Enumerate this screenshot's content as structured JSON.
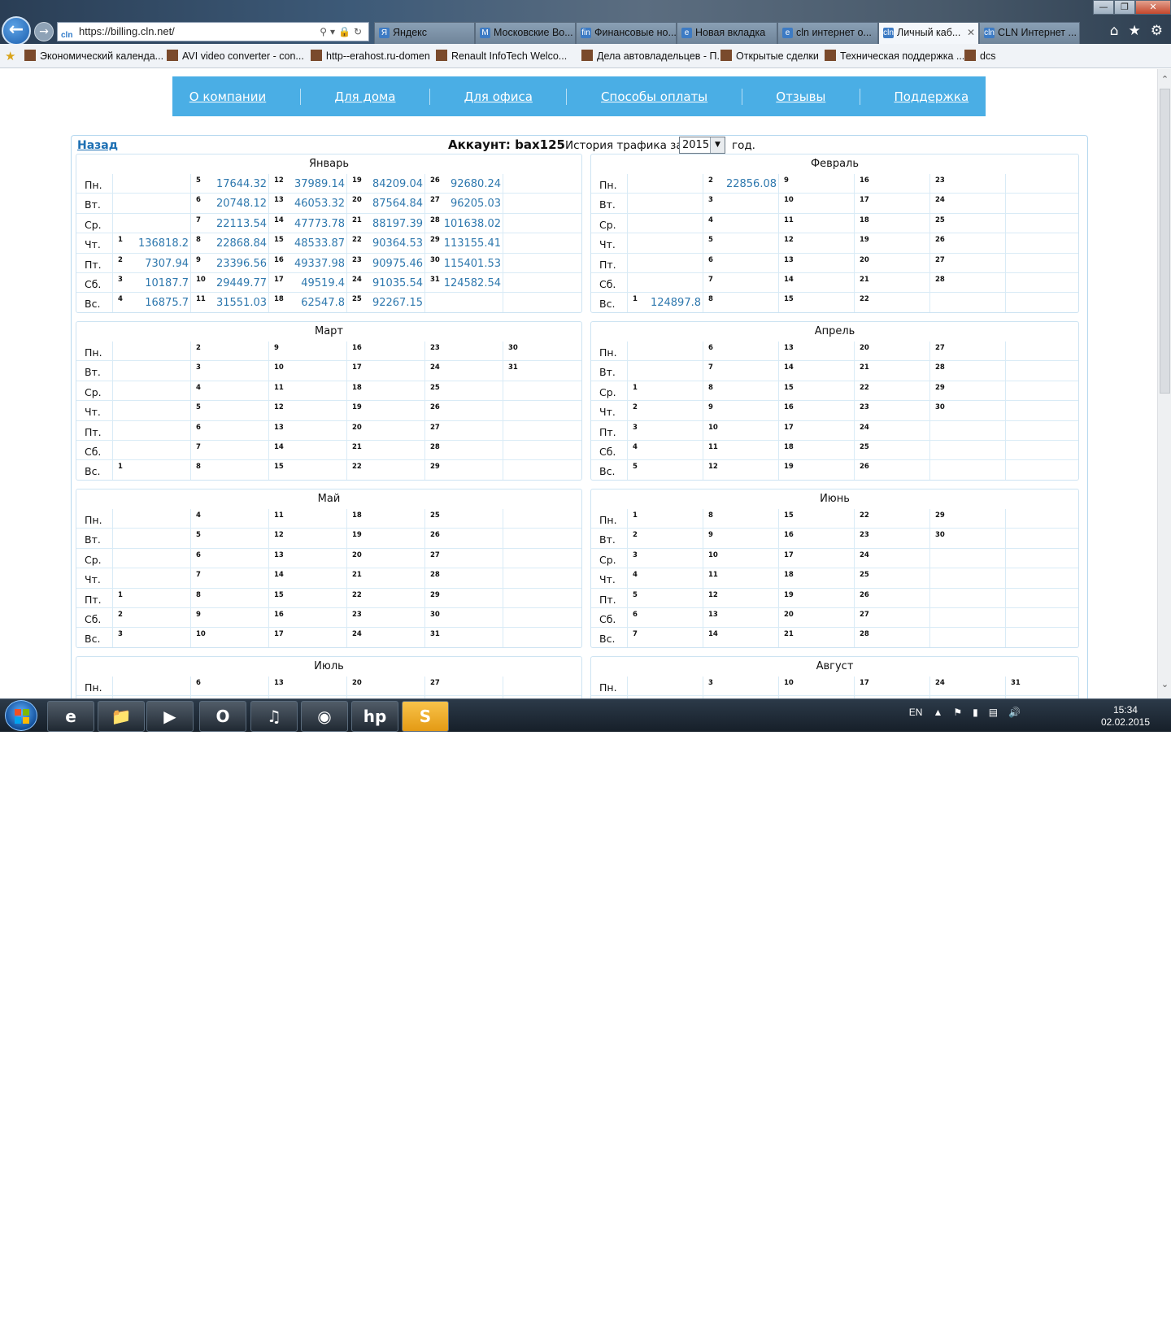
{
  "browser": {
    "url": "https://billing.cln.net/",
    "tabs": [
      {
        "label": "Яндекс",
        "icon": "Я",
        "active": false
      },
      {
        "label": "Московские Во...",
        "icon": "М",
        "active": false
      },
      {
        "label": "Финансовые но...",
        "icon": "fin",
        "active": false
      },
      {
        "label": "Новая вкладка",
        "icon": "e",
        "active": false
      },
      {
        "label": "cln интернет о...",
        "icon": "e",
        "active": false
      },
      {
        "label": "Личный каб...",
        "icon": "cln",
        "active": true
      },
      {
        "label": "CLN Интернет ...",
        "icon": "cln",
        "active": false
      }
    ],
    "favorites": [
      "Экономический календа...",
      "AVI video converter - con...",
      "http--erahost.ru-domen",
      "Renault InfoTech  Welco...",
      "Дела автовладельцев - П...",
      "Открытые сделки",
      "Техническая поддержка ...",
      "dcs"
    ]
  },
  "menu": [
    "О компании",
    "Для дома",
    "Для офиса",
    "Способы оплаты",
    "Отзывы",
    "Поддержка"
  ],
  "header": {
    "back_label": "Назад",
    "account_label": "Аккаунт: bax125",
    "history_label": "История трафика за",
    "year": "2015",
    "year_suffix": "год."
  },
  "weekdays": [
    "Пн.",
    "Вт.",
    "Ср.",
    "Чт.",
    "Пт.",
    "Сб.",
    "Вс."
  ],
  "months": [
    {
      "name": "Январь",
      "start": 3,
      "days": 31,
      "values": {
        "1": "136818.2",
        "2": "7307.94",
        "3": "10187.7",
        "4": "16875.7",
        "5": "17644.32",
        "6": "20748.12",
        "7": "22113.54",
        "8": "22868.84",
        "9": "23396.56",
        "10": "29449.77",
        "11": "31551.03",
        "12": "37989.14",
        "13": "46053.32",
        "14": "47773.78",
        "15": "48533.87",
        "16": "49337.98",
        "17": "49519.4",
        "18": "62547.8",
        "19": "84209.04",
        "20": "87564.84",
        "21": "88197.39",
        "22": "90364.53",
        "23": "90975.46",
        "24": "91035.54",
        "25": "92267.15",
        "26": "92680.24",
        "27": "96205.03",
        "28": "101638.02",
        "29": "113155.41",
        "30": "115401.53",
        "31": "124582.54"
      }
    },
    {
      "name": "Февраль",
      "start": 6,
      "days": 28,
      "values": {
        "1": "124897.8",
        "2": "22856.08"
      }
    },
    {
      "name": "Март",
      "start": 6,
      "days": 31,
      "values": {}
    },
    {
      "name": "Апрель",
      "start": 2,
      "days": 30,
      "values": {}
    },
    {
      "name": "Май",
      "start": 4,
      "days": 31,
      "values": {}
    },
    {
      "name": "Июнь",
      "start": 0,
      "days": 30,
      "values": {}
    },
    {
      "name": "Июль",
      "start": 2,
      "days": 31,
      "values": {}
    },
    {
      "name": "Август",
      "start": 5,
      "days": 31,
      "values": {}
    }
  ],
  "taskbar": {
    "language": "EN",
    "time": "15:34",
    "date": "02.02.2015"
  }
}
